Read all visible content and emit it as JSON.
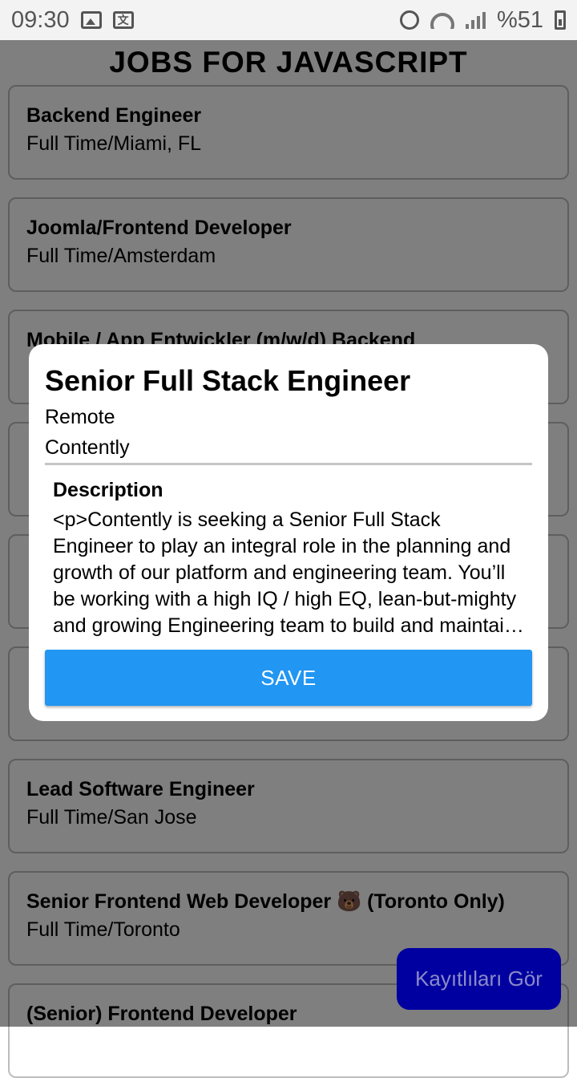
{
  "status_bar": {
    "time": "09:30",
    "battery": "%51",
    "translate_glyph": "文"
  },
  "page": {
    "title": "JOBS FOR JAVASCRIPT",
    "jobs": [
      {
        "title": "Backend Engineer",
        "subtitle": "Full Time/Miami, FL"
      },
      {
        "title": "Joomla/Frontend Developer",
        "subtitle": "Full Time/Amsterdam"
      },
      {
        "title": "Mobile / App Entwickler (m/w/d) Backend",
        "subtitle": ""
      },
      {
        "title": "",
        "subtitle": ""
      },
      {
        "title": "",
        "subtitle": ""
      },
      {
        "title": "",
        "subtitle": ""
      },
      {
        "title": "Lead Software Engineer",
        "subtitle": "Full Time/San Jose"
      },
      {
        "title": "Senior Frontend Web Developer 🐻 (Toronto Only)",
        "subtitle": "Full Time/Toronto"
      },
      {
        "title": "(Senior) Frontend Developer",
        "subtitle": ""
      }
    ]
  },
  "modal": {
    "title": "Senior Full Stack Engineer",
    "location": "Remote",
    "company": "Contently",
    "description_heading": "Description",
    "description": "<p>Contently is seeking a Senior Full Stack Engineer to play an integral role in the planning and growth of our platform and engineering team. You’ll be working with a high IQ / high EQ, lean-but-mighty and growing Engineering team to build and maintain the platform.",
    "save_label": "SAVE"
  },
  "fab": {
    "label": "Kayıtlıları Gör"
  },
  "colors": {
    "save_button": "#2196f3",
    "fab_background": "#0000a0",
    "overlay": "rgba(0,0,0,0.5)"
  }
}
